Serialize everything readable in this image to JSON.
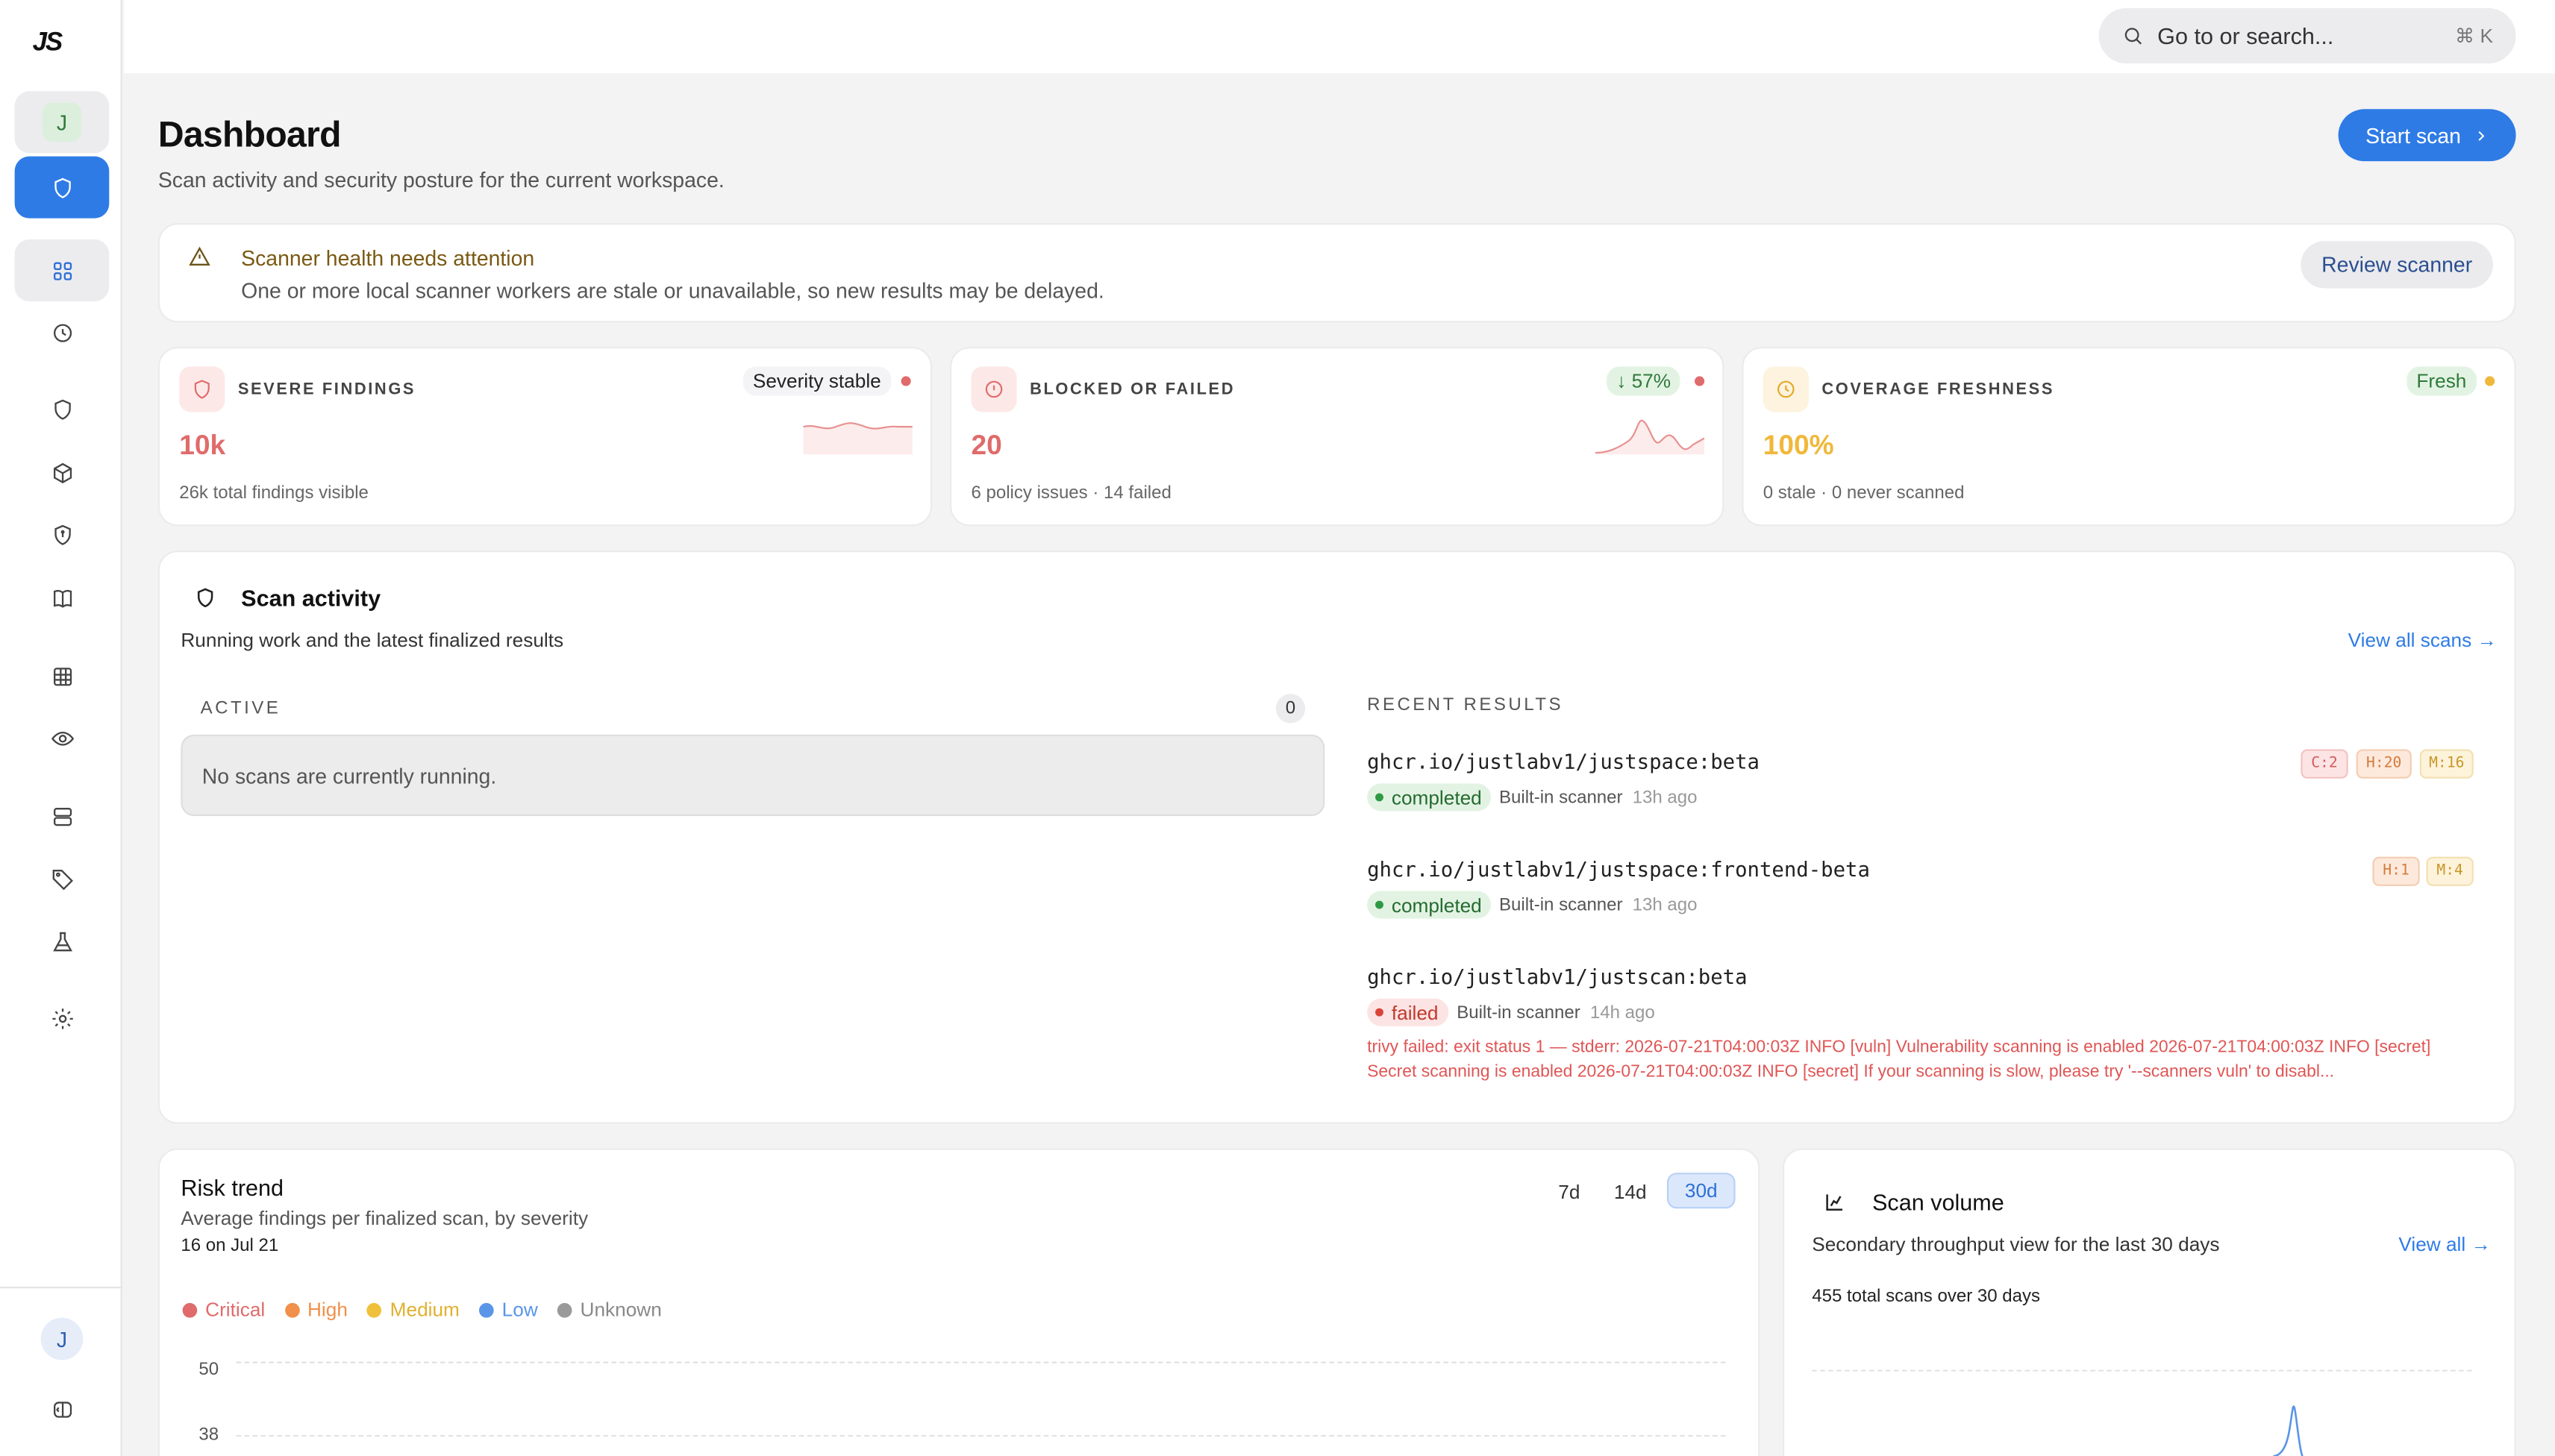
{
  "app": {
    "logo": "JS",
    "workspace_initial": "J",
    "user_initial": "J"
  },
  "search": {
    "placeholder": "Go to or search...",
    "shortcut": "⌘ K"
  },
  "sidebar": {
    "items": [
      {
        "icon": "shield-icon",
        "active": true
      },
      {
        "icon": "grid-icon"
      },
      {
        "icon": "clock-icon"
      },
      {
        "icon": "shield-icon"
      },
      {
        "icon": "box-icon"
      },
      {
        "icon": "shield-lock-icon"
      },
      {
        "icon": "book-icon"
      },
      {
        "icon": "table-icon"
      },
      {
        "icon": "eye-icon"
      },
      {
        "icon": "server-icon"
      },
      {
        "icon": "tag-icon"
      },
      {
        "icon": "flask-icon"
      },
      {
        "icon": "gear-icon"
      }
    ]
  },
  "header": {
    "title": "Dashboard",
    "subtitle": "Scan activity and security posture for the current workspace.",
    "start_scan": "Start scan"
  },
  "alert": {
    "title": "Scanner health needs attention",
    "text": "One or more local scanner workers are stale or unavailable, so new results may be delayed.",
    "button": "Review scanner"
  },
  "kpis": [
    {
      "label": "SEVERE FINDINGS",
      "value": "10k",
      "note": "26k total findings visible",
      "badge": "Severity stable",
      "color": "#e06b6b"
    },
    {
      "label": "BLOCKED OR FAILED",
      "value": "20",
      "note": "6 policy issues · 14 failed",
      "badge": "↓ 57%",
      "color": "#e06b6b"
    },
    {
      "label": "COVERAGE FRESHNESS",
      "value": "100%",
      "note": "0 stale · 0 never scanned",
      "badge": "Fresh",
      "color": "#f0b83a"
    }
  ],
  "activity": {
    "title": "Scan activity",
    "subtitle": "Running work and the latest finalized results",
    "view_all": "View all scans →",
    "active_label": "ACTIVE",
    "active_count": "0",
    "empty": "No scans are currently running.",
    "recent_label": "RECENT RESULTS",
    "results": [
      {
        "name": "ghcr.io/justlabv1/justspace:beta",
        "status": "completed",
        "scanner": "Built-in scanner",
        "ago": "13h ago",
        "sev": [
          "C:2",
          "H:20",
          "M:16"
        ]
      },
      {
        "name": "ghcr.io/justlabv1/justspace:frontend-beta",
        "status": "completed",
        "scanner": "Built-in scanner",
        "ago": "13h ago",
        "sev": [
          "H:1",
          "M:4"
        ]
      },
      {
        "name": "ghcr.io/justlabv1/justscan:beta",
        "status": "failed",
        "scanner": "Built-in scanner",
        "ago": "14h ago",
        "sev": [],
        "error": "trivy failed: exit status 1 — stderr: 2026-07-21T04:00:03Z INFO [vuln] Vulnerability scanning is enabled 2026-07-21T04:00:03Z INFO [secret] Secret scanning is enabled 2026-07-21T04:00:03Z INFO [secret] If your scanning is slow, please try '--scanners vuln' to disabl..."
      }
    ]
  },
  "risk": {
    "title": "Risk trend",
    "subtitle": "Average findings per finalized scan, by severity",
    "hover": "16 on Jul 21",
    "ranges": [
      "7d",
      "14d",
      "30d"
    ],
    "selected_range": "30d",
    "legend": [
      {
        "name": "Critical",
        "color": "#e06b6b"
      },
      {
        "name": "High",
        "color": "#f0904a"
      },
      {
        "name": "Medium",
        "color": "#f0c03a"
      },
      {
        "name": "Low",
        "color": "#5a95e8"
      },
      {
        "name": "Unknown",
        "color": "#9a9a9a"
      }
    ],
    "yticks": [
      "50",
      "38"
    ]
  },
  "volume": {
    "title": "Scan volume",
    "subtitle": "Secondary throughput view for the last 30 days",
    "view_all": "View all →",
    "total": "455 total scans over 30 days"
  }
}
